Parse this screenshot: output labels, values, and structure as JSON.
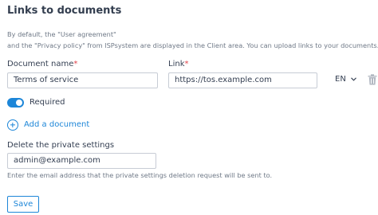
{
  "section": {
    "title": "Links to documents",
    "description": [
      "By default, the \"User agreement\"",
      "and the \"Privacy policy\" from ISPsystem are displayed in the Client area. You can upload links to your documents."
    ]
  },
  "document": {
    "name_label": "Document name",
    "name_value": "Terms of service",
    "link_label": "Link",
    "link_value": "https://tos.example.com",
    "required_mark": "*",
    "language": "EN",
    "required_label": "Required",
    "required_on": true
  },
  "add_document_label": "Add a document",
  "private_settings": {
    "label": "Delete the private settings",
    "email_value": "admin@example.com",
    "hint": "Enter the email address that the private settings deletion request will be sent to."
  },
  "save_label": "Save",
  "colors": {
    "accent": "#1d86d8",
    "required": "#e0434b"
  },
  "icons": {
    "language": "chevron-down-icon",
    "delete": "trash-icon",
    "add": "plus-circle-icon"
  }
}
